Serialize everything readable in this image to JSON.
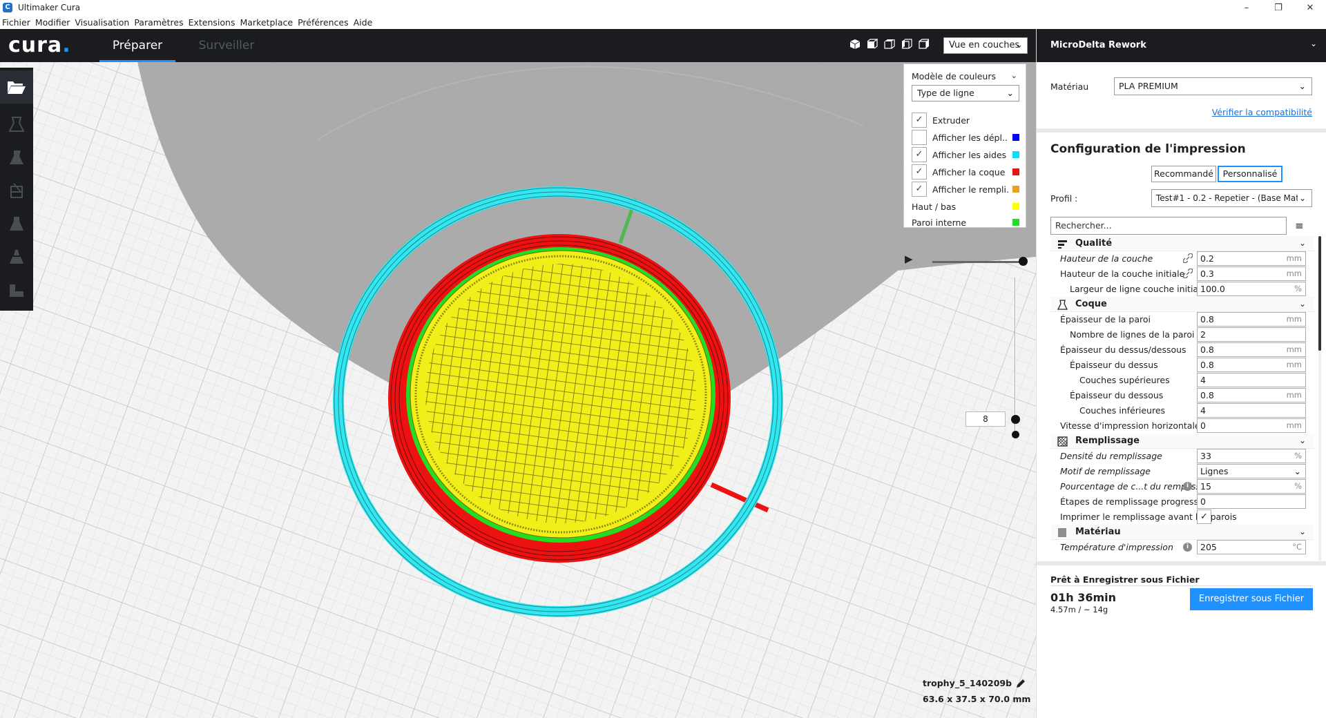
{
  "window": {
    "title": "Ultimaker Cura",
    "app_icon_letter": "C",
    "minimize": "–",
    "restore": "❐",
    "close": "✕"
  },
  "menu": [
    "Fichier",
    "Modifier",
    "Visualisation",
    "Paramètres",
    "Extensions",
    "Marketplace",
    "Préférences",
    "Aide"
  ],
  "header": {
    "logo": "cura",
    "logo_dot": ".",
    "tabs": [
      "Préparer",
      "Surveiller"
    ],
    "view_mode": "Vue en couches"
  },
  "color_scheme": {
    "title": "Modèle de couleurs",
    "selected": "Type de ligne",
    "items": [
      {
        "label": "Extruder",
        "checked": true,
        "swatch": ""
      },
      {
        "label": "Afficher les dépl…",
        "checked": false,
        "swatch": "#0000ff"
      },
      {
        "label": "Afficher les aides",
        "checked": true,
        "swatch": "#00e0ff"
      },
      {
        "label": "Afficher la coque",
        "checked": true,
        "swatch": "#ee1111"
      },
      {
        "label": "Afficher le rempli…",
        "checked": true,
        "swatch": "#f0a020"
      }
    ],
    "legend": [
      {
        "label": "Haut / bas",
        "swatch": "#ffff00"
      },
      {
        "label": "Paroi interne",
        "swatch": "#22dd22"
      }
    ]
  },
  "layer_view": {
    "layer_number": "8"
  },
  "object": {
    "name": "trophy_5_140209b",
    "dimensions": "63.6 x 37.5 x 70.0 mm"
  },
  "sidebar": {
    "printer": "MicroDelta Rework",
    "material_label": "Matériau",
    "material_value": "PLA PREMIUM",
    "compat_link": "Vérifier la compatibilité",
    "config_title": "Configuration de l'impression",
    "mode_buttons": [
      "Recommandé",
      "Personnalisé"
    ],
    "profile_label": "Profil :",
    "profile_value": "Test#1 - 0.2 - Repetier - (Base Mat...",
    "search_placeholder": "Rechercher...",
    "categories": {
      "quality": "Qualité",
      "shell": "Coque",
      "infill": "Remplissage",
      "material": "Matériau"
    },
    "settings": [
      {
        "label": "Hauteur de la couche",
        "value": "0.2",
        "unit": "mm"
      },
      {
        "label": "Hauteur de la couche initiale",
        "value": "0.3",
        "unit": "mm"
      },
      {
        "label": "Largeur de ligne couche initiale",
        "value": "100.0",
        "unit": "%"
      },
      {
        "label": "Épaisseur de la paroi",
        "value": "0.8",
        "unit": "mm"
      },
      {
        "label": "Nombre de lignes de la paroi",
        "value": "2",
        "unit": ""
      },
      {
        "label": "Épaisseur du dessus/dessous",
        "value": "0.8",
        "unit": "mm"
      },
      {
        "label": "Épaisseur du dessus",
        "value": "0.8",
        "unit": "mm"
      },
      {
        "label": "Couches supérieures",
        "value": "4",
        "unit": ""
      },
      {
        "label": "Épaisseur du dessous",
        "value": "0.8",
        "unit": "mm"
      },
      {
        "label": "Couches inférieures",
        "value": "4",
        "unit": ""
      },
      {
        "label": "Vitesse d'impression horizontale",
        "value": "0",
        "unit": "mm"
      },
      {
        "label": "Densité du remplissage",
        "value": "33",
        "unit": "%"
      },
      {
        "label": "Motif de remplissage",
        "value": "Lignes",
        "unit": ""
      },
      {
        "label": "Pourcentage de c...t du remplissage",
        "value": "15",
        "unit": "%"
      },
      {
        "label": "Étapes de remplissage progressif",
        "value": "0",
        "unit": ""
      },
      {
        "label": "Imprimer le remplissage avant les parois",
        "value": "✓",
        "unit": ""
      },
      {
        "label": "Température d'impression",
        "value": "205",
        "unit": "°C"
      }
    ],
    "ready_label": "Prêt à Enregistrer sous Fichier",
    "print_time": "01h 36min",
    "print_material": "4.57m / ~ 14g",
    "save_button": "Enregistrer sous Fichier"
  },
  "colors": {
    "accent": "#1f91ff",
    "dark_header": "#1a1c20",
    "skirt": "#33e6f0",
    "shell": "#ee1111",
    "inner_wall": "#22dd22",
    "top_bottom": "#ffff00"
  }
}
